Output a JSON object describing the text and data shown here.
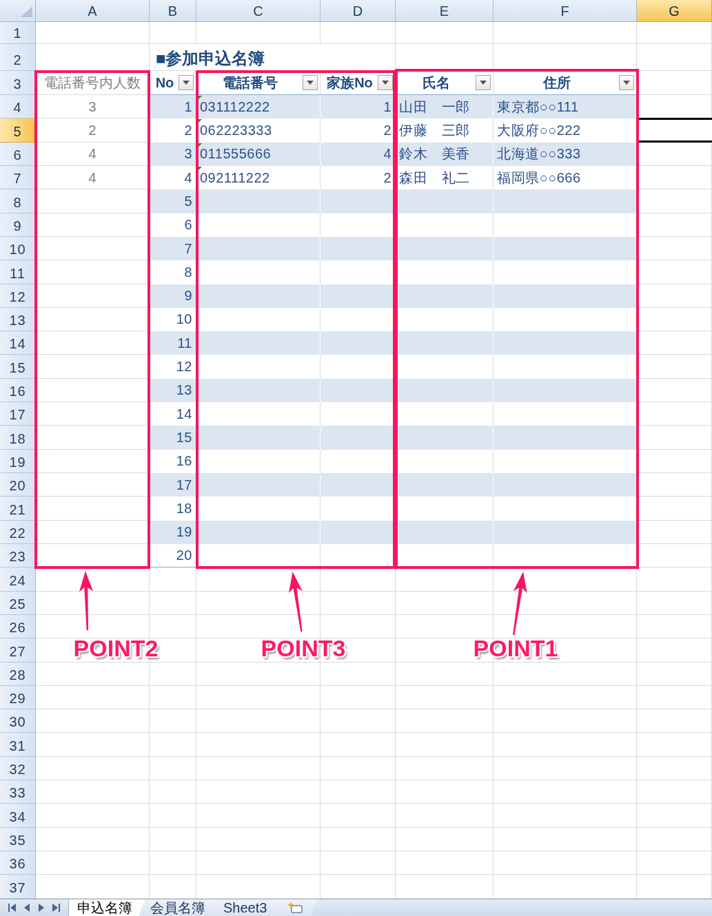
{
  "columns": [
    {
      "label": "A",
      "selected": false
    },
    {
      "label": "B",
      "selected": false
    },
    {
      "label": "C",
      "selected": false
    },
    {
      "label": "D",
      "selected": false
    },
    {
      "label": "E",
      "selected": false
    },
    {
      "label": "F",
      "selected": false
    },
    {
      "label": "G",
      "selected": true
    }
  ],
  "rows": [
    {
      "label": "1",
      "selected": false
    },
    {
      "label": "2",
      "selected": false
    },
    {
      "label": "3",
      "selected": false
    },
    {
      "label": "4",
      "selected": false
    },
    {
      "label": "5",
      "selected": true
    },
    {
      "label": "6",
      "selected": false
    },
    {
      "label": "7",
      "selected": false
    },
    {
      "label": "8",
      "selected": false
    },
    {
      "label": "9",
      "selected": false
    },
    {
      "label": "10",
      "selected": false
    },
    {
      "label": "11",
      "selected": false
    },
    {
      "label": "12",
      "selected": false
    },
    {
      "label": "13",
      "selected": false
    },
    {
      "label": "14",
      "selected": false
    },
    {
      "label": "15",
      "selected": false
    },
    {
      "label": "16",
      "selected": false
    },
    {
      "label": "17",
      "selected": false
    },
    {
      "label": "18",
      "selected": false
    },
    {
      "label": "19",
      "selected": false
    },
    {
      "label": "20",
      "selected": false
    },
    {
      "label": "21",
      "selected": false
    },
    {
      "label": "22",
      "selected": false
    },
    {
      "label": "23",
      "selected": false
    },
    {
      "label": "24",
      "selected": false
    },
    {
      "label": "25",
      "selected": false
    },
    {
      "label": "26",
      "selected": false
    },
    {
      "label": "27",
      "selected": false
    },
    {
      "label": "28",
      "selected": false
    },
    {
      "label": "29",
      "selected": false
    },
    {
      "label": "30",
      "selected": false
    },
    {
      "label": "31",
      "selected": false
    },
    {
      "label": "32",
      "selected": false
    },
    {
      "label": "33",
      "selected": false
    },
    {
      "label": "34",
      "selected": false
    },
    {
      "label": "35",
      "selected": false
    },
    {
      "label": "36",
      "selected": false
    },
    {
      "label": "37",
      "selected": false
    }
  ],
  "title": "■参加申込名簿",
  "count_column": {
    "header": "電話番号内人数",
    "values": [
      "3",
      "2",
      "4",
      "4"
    ]
  },
  "table": {
    "columns": [
      "No",
      "電話番号",
      "家族No",
      "氏名",
      "住所"
    ],
    "rows": [
      {
        "cells": [
          "1",
          "031112222",
          "1",
          "山田　一郎",
          "東京都○○111"
        ],
        "error_indicator": true
      },
      {
        "cells": [
          "2",
          "062223333",
          "2",
          "伊藤　三郎",
          "大阪府○○222"
        ],
        "error_indicator": true
      },
      {
        "cells": [
          "3",
          "011555666",
          "4",
          "鈴木　美香",
          "北海道○○333"
        ],
        "error_indicator": true
      },
      {
        "cells": [
          "4",
          "092111222",
          "2",
          "森田　礼二",
          "福岡県○○666"
        ],
        "error_indicator": true
      },
      {
        "cells": [
          "5"
        ],
        "error_indicator": false
      },
      {
        "cells": [
          "6"
        ],
        "error_indicator": false
      },
      {
        "cells": [
          "7"
        ],
        "error_indicator": false
      },
      {
        "cells": [
          "8"
        ],
        "error_indicator": false
      },
      {
        "cells": [
          "9"
        ],
        "error_indicator": false
      },
      {
        "cells": [
          "10"
        ],
        "error_indicator": false
      },
      {
        "cells": [
          "11"
        ],
        "error_indicator": false
      },
      {
        "cells": [
          "12"
        ],
        "error_indicator": false
      },
      {
        "cells": [
          "13"
        ],
        "error_indicator": false
      },
      {
        "cells": [
          "14"
        ],
        "error_indicator": false
      },
      {
        "cells": [
          "15"
        ],
        "error_indicator": false
      },
      {
        "cells": [
          "16"
        ],
        "error_indicator": false
      },
      {
        "cells": [
          "17"
        ],
        "error_indicator": false
      },
      {
        "cells": [
          "18"
        ],
        "error_indicator": false
      },
      {
        "cells": [
          "19"
        ],
        "error_indicator": false
      },
      {
        "cells": [
          "20"
        ],
        "error_indicator": false
      }
    ]
  },
  "annotations": [
    {
      "label": "POINT2"
    },
    {
      "label": "POINT3"
    },
    {
      "label": "POINT1"
    }
  ],
  "sheet_tabs": [
    {
      "label": "申込名簿",
      "selected": true
    },
    {
      "label": "会員名簿",
      "selected": false
    },
    {
      "label": "Sheet3",
      "selected": false
    }
  ]
}
